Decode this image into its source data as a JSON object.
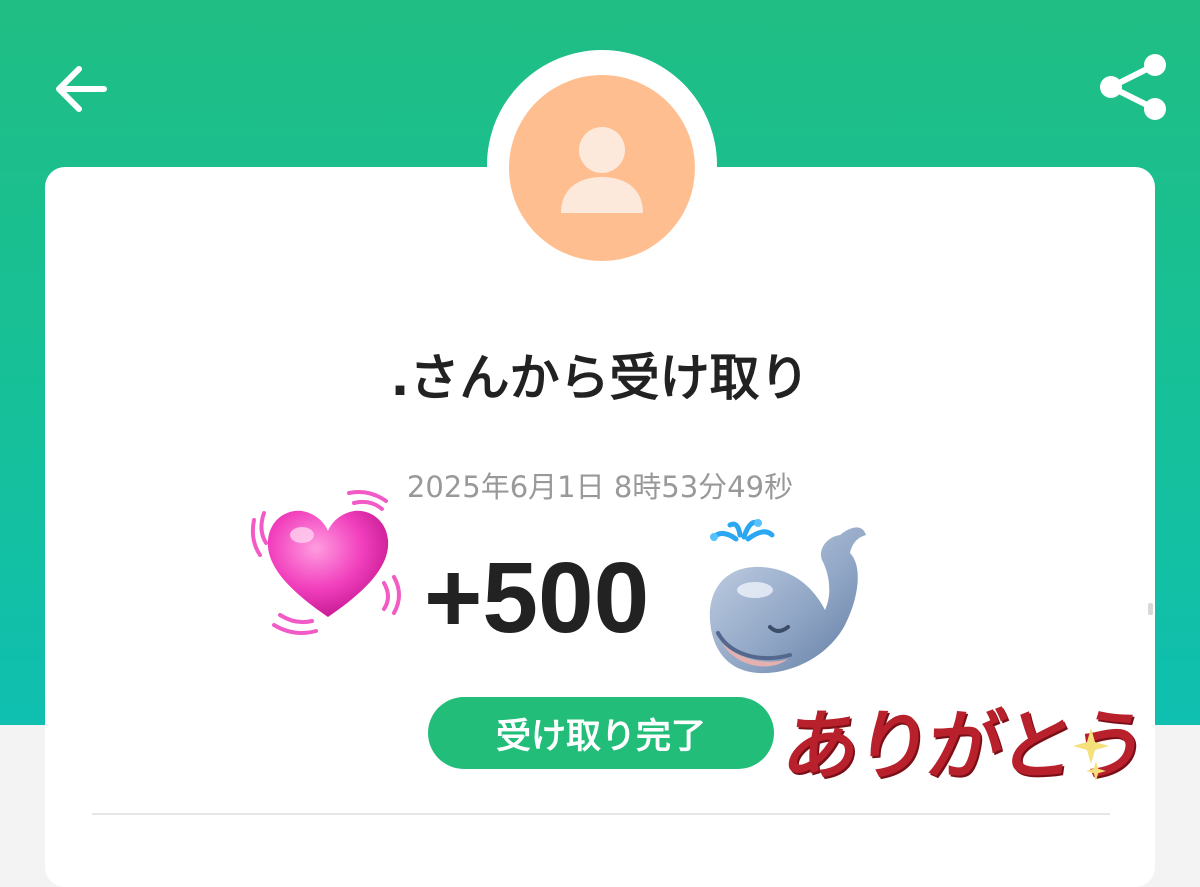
{
  "header": {
    "back_icon": "arrow-left-icon",
    "share_icon": "share-icon",
    "gradient_top": "#20be84",
    "gradient_bottom": "#0fbfb0"
  },
  "profile": {
    "avatar_icon": "user-icon",
    "avatar_color": "#ffbe8f"
  },
  "transaction": {
    "title": ".さんから受け取り",
    "timestamp": "2025年6月1日 8時53分49秒",
    "amount": "+500",
    "status": "受け取り完了",
    "status_color": "#21bd79"
  },
  "stickers": {
    "heart": "heart-sticker",
    "whale": "whale-sticker",
    "thanks_text": "ありがとう"
  }
}
